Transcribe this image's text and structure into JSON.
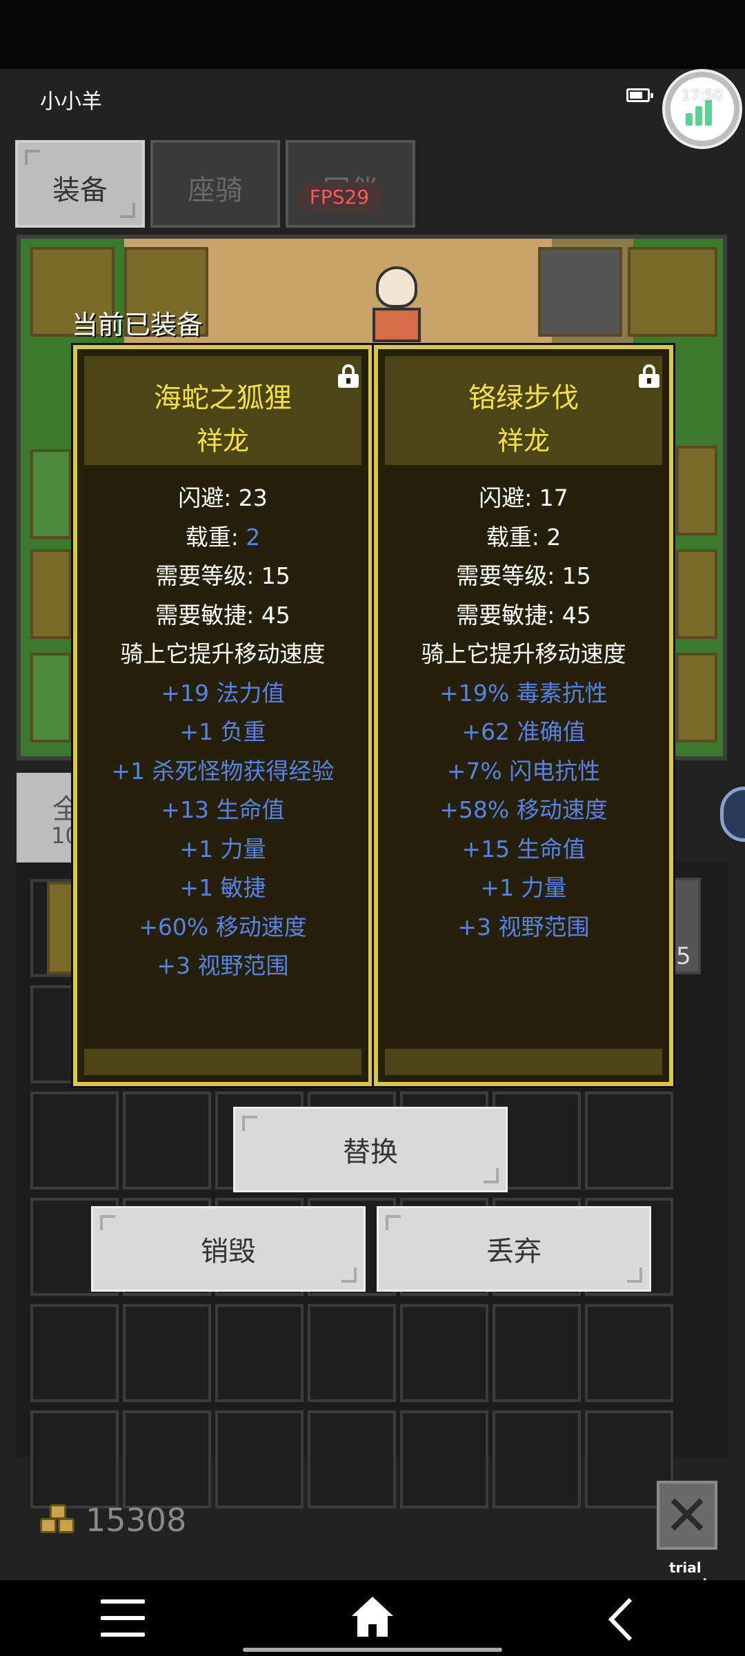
{
  "status": {
    "player_name": "小小羊",
    "time": "17:50"
  },
  "tabs": [
    {
      "label": "装备"
    },
    {
      "label": "座骑"
    },
    {
      "label": "同伴"
    }
  ],
  "fps": "FPS29",
  "current_label": "当前已装备",
  "cards": [
    {
      "name": "海蛇之狐狸",
      "owner": "祥龙",
      "stats": [
        {
          "text": "闪避: 23",
          "color": "white"
        },
        {
          "text": "载重: ",
          "value": "2",
          "color": "white"
        },
        {
          "text": "需要等级: 15",
          "color": "white"
        },
        {
          "text": "需要敏捷: 45",
          "color": "white"
        },
        {
          "text": "骑上它提升移动速度",
          "color": "white"
        },
        {
          "text": "+19 法力值",
          "color": "blue"
        },
        {
          "text": "+1 负重",
          "color": "blue"
        },
        {
          "text": "+1 杀死怪物获得经验",
          "color": "blue"
        },
        {
          "text": "+13 生命值",
          "color": "blue"
        },
        {
          "text": "+1 力量",
          "color": "blue"
        },
        {
          "text": "+1 敏捷",
          "color": "blue"
        },
        {
          "text": "+60% 移动速度",
          "color": "blue"
        },
        {
          "text": "+3 视野范围",
          "color": "blue"
        }
      ]
    },
    {
      "name": "铬绿步伐",
      "owner": "祥龙",
      "stats": [
        {
          "text": "闪避: 17",
          "color": "white"
        },
        {
          "text": "载重: 2",
          "color": "white"
        },
        {
          "text": "需要等级: 15",
          "color": "white"
        },
        {
          "text": "需要敏捷: 45",
          "color": "white"
        },
        {
          "text": "骑上它提升移动速度",
          "color": "white"
        },
        {
          "text": "+19% 毒素抗性",
          "color": "blue"
        },
        {
          "text": "+62 准确值",
          "color": "blue"
        },
        {
          "text": "+7% 闪电抗性",
          "color": "blue"
        },
        {
          "text": "+58% 移动速度",
          "color": "blue"
        },
        {
          "text": "+15 生命值",
          "color": "blue"
        },
        {
          "text": "+1 力量",
          "color": "blue"
        },
        {
          "text": "+3 视野范围",
          "color": "blue"
        }
      ]
    }
  ],
  "side_tab": {
    "line1": "全",
    "line2": "10"
  },
  "slot_count": "5",
  "actions": {
    "replace": "替换",
    "destroy": "销毁",
    "discard": "丢弃"
  },
  "gold": "15308",
  "trial": "trial version",
  "colors": {
    "card_border": "#d8c84e",
    "name_yellow": "#f5e04a",
    "stat_blue": "#5a82e6",
    "fps_red": "#ff5a5a"
  },
  "icons": [
    "battery-icon",
    "fps-widget-icon",
    "lock-icon",
    "gold-coins-icon",
    "close-icon",
    "menu-icon",
    "home-icon",
    "back-icon"
  ]
}
